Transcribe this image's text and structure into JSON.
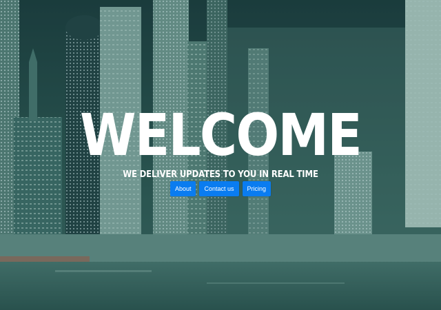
{
  "hero": {
    "title": "WELCOME",
    "subtitle": "WE DELIVER UPDATES TO YOU IN REAL TIME",
    "buttons": [
      {
        "label": "About"
      },
      {
        "label": "Contact us"
      },
      {
        "label": "Pricing"
      }
    ]
  },
  "colors": {
    "overlay": "#2e5a58",
    "button_bg": "#0a7cf0",
    "text": "#ffffff"
  },
  "background": {
    "subject": "city-skyline-waterfront-photo"
  }
}
